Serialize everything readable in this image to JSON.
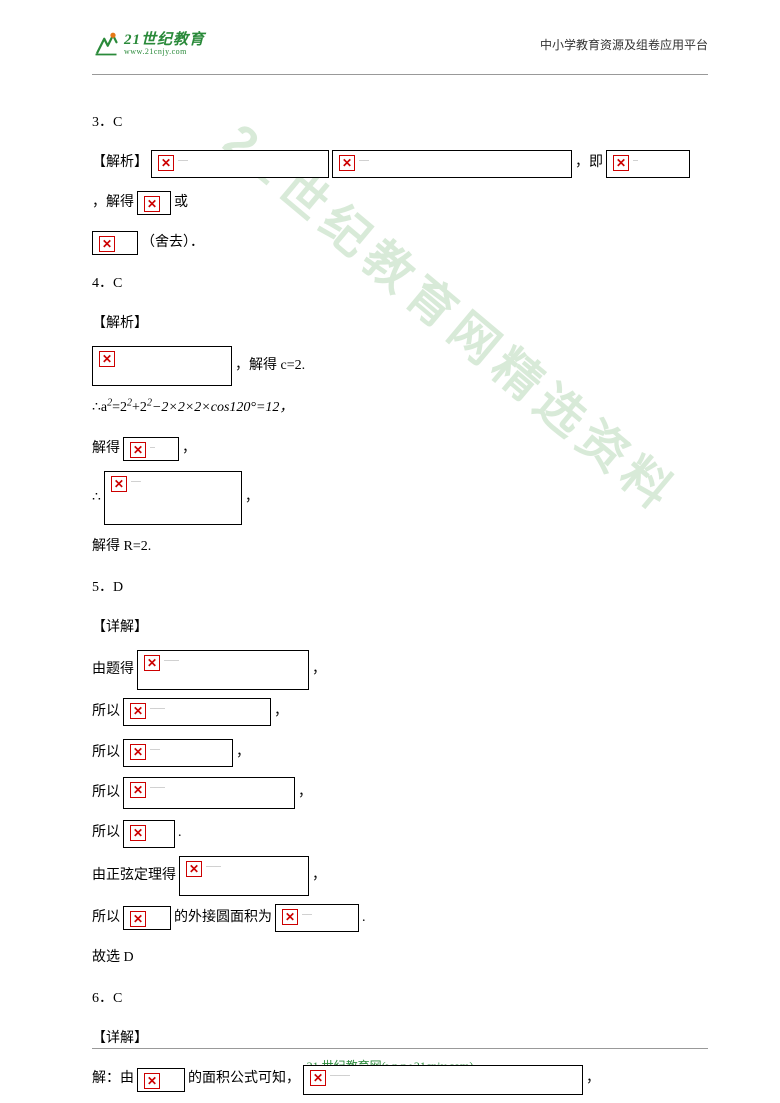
{
  "header": {
    "brand": "21世纪教育",
    "brand_url": "www.21cnjy.com",
    "right": "中小学教育资源及组卷应用平台"
  },
  "watermark": "21世纪教育网精选资料",
  "q3": {
    "num": "3．C",
    "label": "【解析】",
    "mid": "，即",
    "jd": "，解得",
    "huo": "或",
    "shequ": "（舍去）．"
  },
  "q4": {
    "num": "4．C",
    "label": "【解析】",
    "jd_c": "，解得 c=2.",
    "eq": "∴a",
    "eq2": "=2",
    "eq3": "+2",
    "eq4": "−2×2×2×cos120°=12，",
    "jd": "解得",
    "comma": "，",
    "dot": "∴",
    "jdr": "解得 R=2."
  },
  "q5": {
    "num": "5．D",
    "label": "【详解】",
    "l1": "由题得",
    "l2": "所以",
    "sine": "由正弦定理得",
    "circle_a": "所以",
    "circle_b": "的外接圆面积为",
    "end": ".",
    "gu": "故选 D"
  },
  "q6": {
    "num": "6．C",
    "label": "【详解】",
    "l1a": "解：由",
    "l1b": "的面积公式可知，",
    "comma": "，"
  },
  "footer": {
    "text": "21 世纪教育网(www.21cnjy.com)"
  }
}
